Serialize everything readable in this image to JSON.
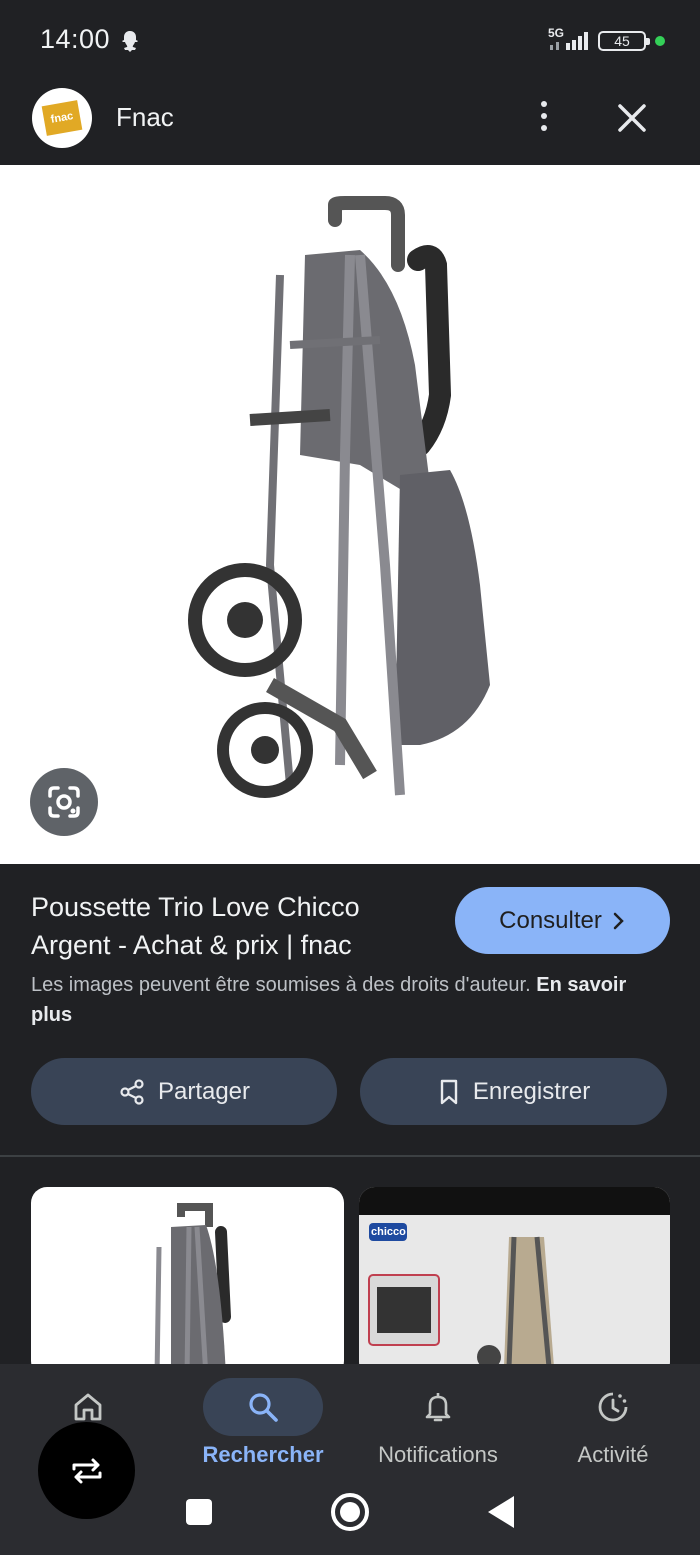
{
  "status_bar": {
    "time": "14:00",
    "network": "5G",
    "battery": "45",
    "icons": [
      "snapchat-icon",
      "signal-icon",
      "battery-icon"
    ]
  },
  "header": {
    "logo_text": "fnac",
    "site_name": "Fnac",
    "icons": [
      "more-vert-icon",
      "close-icon"
    ]
  },
  "result": {
    "title": "Poussette Trio Love Chicco Argent - Achat & prix | fnac",
    "consult_label": "Consulter",
    "copyright_text": "Les images peuvent être soumises à des droits d'auteur.",
    "learn_more": "En savoir plus",
    "share_label": "Partager",
    "save_label": "Enregistrer"
  },
  "thumbnails": [
    {
      "caption": ""
    },
    {
      "brand": "chicco"
    }
  ],
  "bottom_nav": {
    "items": [
      {
        "label": "Accueil",
        "icon": "home-icon",
        "active": false
      },
      {
        "label": "Rechercher",
        "icon": "search-icon",
        "active": true
      },
      {
        "label": "Notifications",
        "icon": "bell-icon",
        "active": false
      },
      {
        "label": "Activité",
        "icon": "activity-icon",
        "active": false
      }
    ]
  },
  "colors": {
    "background": "#202124",
    "accent": "#8ab4f8",
    "chip": "#394456",
    "fnac_yellow": "#e1a925"
  }
}
